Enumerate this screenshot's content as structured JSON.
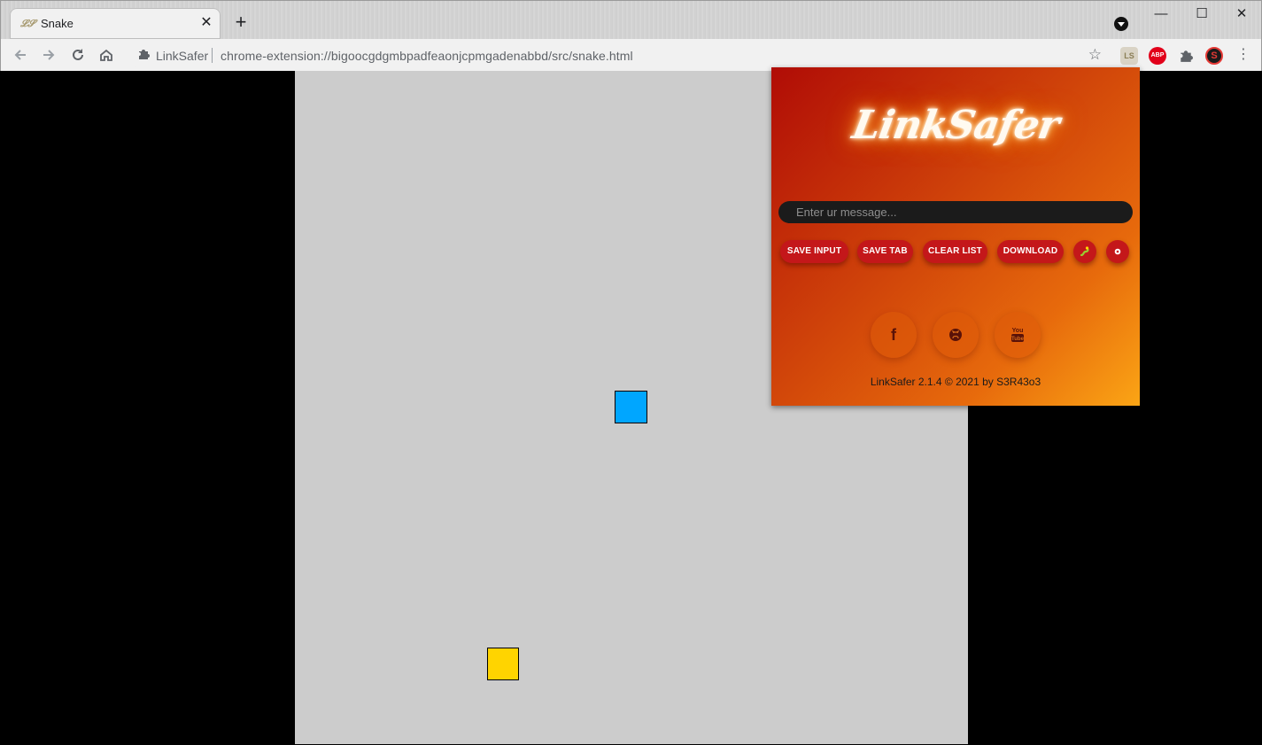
{
  "browser": {
    "tab_title": "Snake",
    "tab_favicon": "linksafer-favicon",
    "tab_close": "✕",
    "new_tab": "+",
    "window_controls": {
      "minimize": "—",
      "maximize": "☐",
      "close": "✕"
    },
    "omnibox": {
      "origin": "LinkSafer",
      "url": "chrome-extension://bigoocgdgmbpadfeaonjcpmgadenabbd/src/snake.html"
    },
    "extensions": [
      {
        "name": "linksafer-extension-icon",
        "label": "LS"
      },
      {
        "name": "adblock-plus-icon",
        "label": "ABP"
      },
      {
        "name": "extensions-puzzle-icon",
        "label": ""
      },
      {
        "name": "red-s-extension-icon",
        "label": "S"
      }
    ]
  },
  "game": {
    "snake_color": "#00a6ff",
    "food_color": "#ffd400",
    "board_color": "#cccccc"
  },
  "popup": {
    "logo": "LinkSafer",
    "input_placeholder": "Enter ur message...",
    "buttons": {
      "save_input": "SAVE INPUT",
      "save_tab": "SAVE TAB",
      "clear_list": "CLEAR LIST",
      "download": "DOWNLOAD"
    },
    "icon_buttons": [
      "snake-icon",
      "gear-icon"
    ],
    "social": [
      "facebook-icon",
      "github-icon",
      "youtube-icon"
    ],
    "social_labels": {
      "facebook": "f",
      "youtube": "You\nTube"
    },
    "footer": "LinkSafer 2.1.4 © 2021 by S3R43o3"
  }
}
